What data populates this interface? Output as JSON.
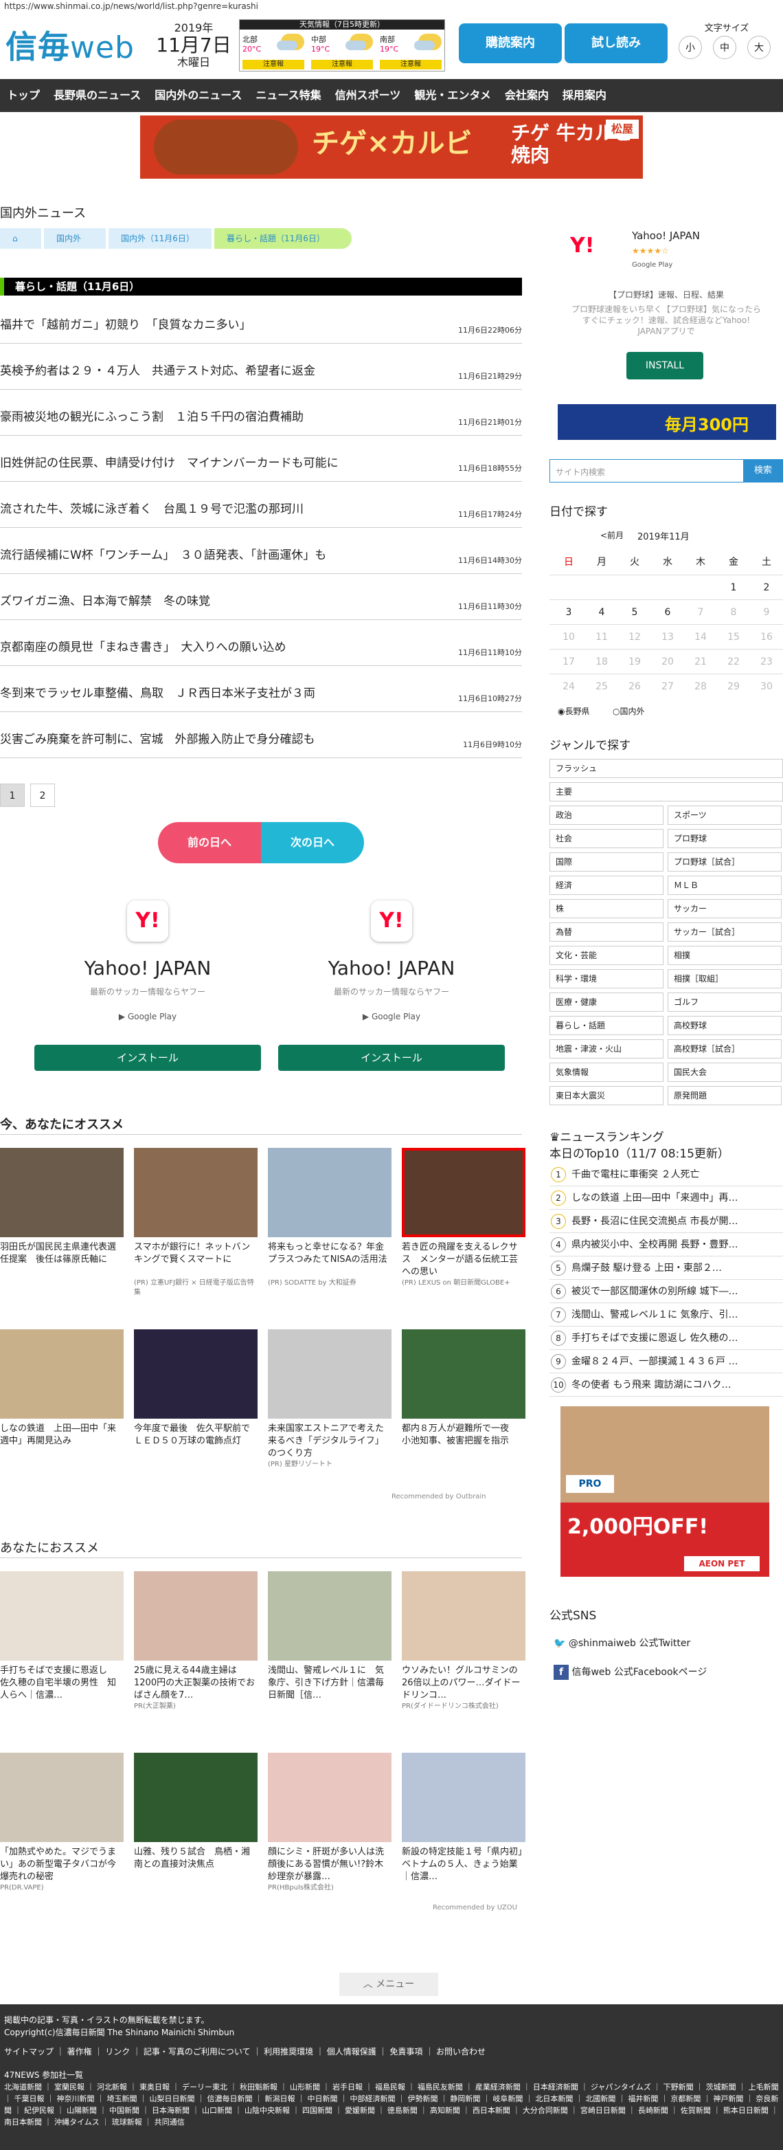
{
  "url": "https://www.shinmai.co.jp/news/world/list.php?genre=kurashi",
  "logo": {
    "main": "信毎",
    "sub": "web"
  },
  "date": {
    "year": "2019年",
    "md": "11月7日",
    "wd": "木曜日"
  },
  "weather": {
    "title": "天気情報（7日5時更新）",
    "cols": [
      {
        "name": "北部",
        "hi": "20°C",
        "lo": "",
        "chance": "注意報"
      },
      {
        "name": "中部",
        "hi": "19°C",
        "lo": "",
        "chance": "注意報"
      },
      {
        "name": "南部",
        "hi": "19°C",
        "lo": "",
        "chance": "注意報"
      }
    ]
  },
  "buttons": {
    "subscribe": "購読案内",
    "trial": "試し読み"
  },
  "fontsize": {
    "label": "文字サイズ",
    "s": "小",
    "m": "中",
    "l": "大"
  },
  "nav": [
    "トップ",
    "長野県のニュース",
    "国内外のニュース",
    "ニュース特集",
    "信州スポーツ",
    "観光・エンタメ",
    "会社案内",
    "採用案内"
  ],
  "banner": {
    "t1": "チゲ×カルビ",
    "t2": "チゲ 牛カルビ焼肉",
    "mark": "松屋"
  },
  "section_title": "国内外ニュース",
  "breadcrumb": [
    "国内外",
    "国内外（11月6日）",
    "暮らし・話題（11月6日）"
  ],
  "catbar": "暮らし・話題（11月6日）",
  "news": [
    {
      "t": "福井で「越前ガニ」初競り　「良質なカニ多い」",
      "d": "11月6日22時06分"
    },
    {
      "t": "英検予約者は２９・４万人　共通テスト対応、希望者に返金",
      "d": "11月6日21時29分"
    },
    {
      "t": "豪雨被災地の観光にふっこう割　１泊５千円の宿泊費補助",
      "d": "11月6日21時01分"
    },
    {
      "t": "旧姓併記の住民票、申請受け付け　マイナンバーカードも可能に",
      "d": "11月6日18時55分"
    },
    {
      "t": "流された牛、茨城に泳ぎ着く　台風１９号で氾濫の那珂川",
      "d": "11月6日17時24分"
    },
    {
      "t": "流行語候補にW杯「ワンチーム」　３０語発表、「計画運休」も",
      "d": "11月6日14時30分"
    },
    {
      "t": "ズワイガニ漁、日本海で解禁　冬の味覚",
      "d": "11月6日11時30分"
    },
    {
      "t": "京都南座の顔見世「まねき書き」　大入りへの願い込め",
      "d": "11月6日11時10分"
    },
    {
      "t": "冬到来でラッセル車整備、鳥取　ＪＲ西日本米子支社が３両",
      "d": "11月6日10時27分"
    },
    {
      "t": "災害ごみ廃棄を許可制に、宮城　外部搬入防止で身分確認も",
      "d": "11月6日9時10分"
    }
  ],
  "pages": [
    "1",
    "2"
  ],
  "daybtns": {
    "prev": "前の日へ",
    "next": "次の日へ"
  },
  "yad": {
    "title": "Yahoo! JAPAN",
    "sub": "最新のサッカー情報ならヤフー",
    "gp": "Google Play",
    "btn": "インストール"
  },
  "reco_title": "今、あなたにオススメ",
  "reco": [
    {
      "c": "羽田氏が国民民主県連代表選任提案　後任は篠原氏軸に",
      "p": ""
    },
    {
      "c": "スマホが銀行に！ネットバンキングで賢くスマートに",
      "p": "(PR) 立憲UFJ銀行 × 日経電子版広告特集"
    },
    {
      "c": "将来もっと幸せになる？年金プラスつみたてNISAの活用法",
      "p": "(PR) SODATTE by 大和証券"
    },
    {
      "c": "若き匠の飛躍を支えるレクサス　メンターが語る伝統工芸への思い",
      "p": "(PR) LEXUS on 朝日新聞GLOBE+"
    },
    {
      "c": "しなの鉄道　上田―田中「来週中」再開見込み",
      "p": ""
    },
    {
      "c": "今年度で最後　佐久平駅前でＬＥＤ５０万球の電飾点灯",
      "p": ""
    },
    {
      "c": "未来国家エストニアで考えた来るべき「デジタルライフ」のつくり方",
      "p": "(PR) 星野リゾートト"
    },
    {
      "c": "都内８万人が避難所で一夜　小池知事、被害把握を指示",
      "p": ""
    }
  ],
  "outbrain": "Recommended by Outbrain",
  "reco2_title": "あなたにおススメ",
  "reco2": [
    {
      "c": "手打ちそばで支援に恩返し　佐久穂の自宅半壊の男性　知人らへ｜信濃…",
      "p": ""
    },
    {
      "c": "25歳に見える44歳主婦は1200円の大正製薬の技術でおばさん顔を7…",
      "p": "PR(大正製薬)"
    },
    {
      "c": "浅間山、警戒レベル１に　気象庁、引き下げ方針｜信濃毎日新聞［信…",
      "p": ""
    },
    {
      "c": "ウソみたい！グルコサミンの26倍以上のパワー…ダイドードリンコ…",
      "p": "PR(ダイドードリンコ株式会社)"
    },
    {
      "c": "「加熱式やめた。マジでうまい」あの新型電子タバコが今爆売れの秘密",
      "p": "PR(DR.VAPE)"
    },
    {
      "c": "山雅、残り５試合　鳥栖・湘南との直接対決焦点",
      "p": ""
    },
    {
      "c": "顔にシミ・肝斑が多い人は洗顔後にある習慣が無い!?鈴木紗理奈が暴露…",
      "p": "PR(HBpuls株式会社)"
    },
    {
      "c": "新設の特定技能１号「県内初」　ベトナムの５人、きょう始業｜信濃…",
      "p": ""
    }
  ],
  "uzou": "Recommended by UZOU",
  "menu": "メニュー",
  "side_yad": {
    "name": "Yahoo! JAPAN",
    "stars": "★★★★☆",
    "gp": "Google Play",
    "cat": "【プロ野球】速報、日程、結果",
    "desc": "プロ野球速報をいち早く【プロ野球】気になったらすぐにチェック！速報、試合経過などYahoo! JAPANアプリで",
    "btn": "INSTALL"
  },
  "side_banner": "毎月300円",
  "search": {
    "placeholder": "サイト内検索",
    "btn": "検索"
  },
  "cal": {
    "title": "日付で探す",
    "prev": "<前月",
    "month": "2019年11月",
    "wd": [
      "日",
      "月",
      "火",
      "水",
      "木",
      "金",
      "土"
    ],
    "rows": [
      [
        "",
        "",
        "",
        "",
        "",
        "1",
        "2"
      ],
      [
        "3",
        "4",
        "5",
        "6",
        "7",
        "8",
        "9"
      ],
      [
        "10",
        "11",
        "12",
        "13",
        "14",
        "15",
        "16"
      ],
      [
        "17",
        "18",
        "19",
        "20",
        "21",
        "22",
        "23"
      ],
      [
        "24",
        "25",
        "26",
        "27",
        "28",
        "29",
        "30"
      ]
    ],
    "radio1": "長野県",
    "radio2": "国内外"
  },
  "genre_title": "ジャンルで探す",
  "genres": [
    [
      "フラッシュ"
    ],
    [
      "主要"
    ],
    [
      "政治",
      "スポーツ"
    ],
    [
      "社会",
      "プロ野球"
    ],
    [
      "国際",
      "プロ野球［試合］"
    ],
    [
      "経済",
      "ＭＬＢ"
    ],
    [
      "株",
      "サッカー"
    ],
    [
      "為替",
      "サッカー［試合］"
    ],
    [
      "文化・芸能",
      "相撲"
    ],
    [
      "科学・環境",
      "相撲［取組］"
    ],
    [
      "医療・健康",
      "ゴルフ"
    ],
    [
      "暮らし・話題",
      "高校野球"
    ],
    [
      "地震・津波・火山",
      "高校野球［試合］"
    ],
    [
      "気象情報",
      "国民大会"
    ],
    [
      "東日本大震災",
      "原発問題"
    ]
  ],
  "ranking_title": "ニュースランキング",
  "ranking_sub": "本日のTop10（11/7 08:15更新）",
  "ranking": [
    "千曲で電柱に車衝突 ２人死亡",
    "しなの鉄道 上田―田中「来週中」再…",
    "長野・長沼に住民交流拠点 市長が開…",
    "県内被災小中、全校再開 長野・豊野…",
    "鳥爛子鼓 駆け登る 上田・東部２…",
    "被災で一部区間運休の別所線 城下―…",
    "浅間山、警戒レベル１に 気象庁、引…",
    "手打ちそばで支援に恩返し 佐久穂の…",
    "金曜８２４戸、一部撲滅１４３６戸 …",
    "冬の使者 もう飛来 諏訪湖にコハク…"
  ],
  "pet": {
    "brand": "PRO",
    "price": "2,000円OFF!",
    "store": "AEON PET"
  },
  "sns_title": "公式SNS",
  "sns": [
    "@shinmaiweb 公式Twitter",
    "信毎web 公式Facebookページ"
  ],
  "footer": {
    "notice": "掲載中の記事・写真・イラストの無断転載を禁じます。",
    "copy": "Copyright(c)信濃毎日新聞 The Shinano Mainichi Shimbun",
    "links": "サイトマップ ｜ 著作権 ｜ リンク ｜ 記事・写真のご利用について ｜ 利用推奨環境 ｜ 個人情報保護 ｜ 免責事項 ｜ お問い合わせ",
    "news47": "47NEWS 参加社一覧",
    "papers": "北海道新聞 ｜ 室蘭民報 ｜ 河北新報 ｜ 東奥日報 ｜ デーリー東北 ｜ 秋田魁新報 ｜ 山形新聞 ｜ 岩手日報 ｜ 福島民報 ｜ 福島民友新聞 ｜ 産業経済新聞 ｜ 日本経済新聞 ｜ ジャパンタイムズ ｜ 下野新聞 ｜ 茨城新聞 ｜ 上毛新聞 ｜ 千葉日報 ｜ 神奈川新聞 ｜ 埼玉新聞 ｜ 山梨日日新聞 ｜ 信濃毎日新聞 ｜ 新潟日報 ｜ 中日新聞 ｜ 中部経済新聞 ｜ 伊勢新聞 ｜ 静岡新聞 ｜ 岐阜新聞 ｜ 北日本新聞 ｜ 北國新聞 ｜ 福井新聞 ｜ 京都新聞 ｜ 神戸新聞 ｜ 奈良新聞 ｜ 紀伊民報 ｜ 山陽新聞 ｜ 中国新聞 ｜ 日本海新聞 ｜ 山口新聞 ｜ 山陰中央新報 ｜ 四国新聞 ｜ 愛媛新聞 ｜ 徳島新聞 ｜ 高知新聞 ｜ 西日本新聞 ｜ 大分合同新聞 ｜ 宮崎日日新聞 ｜ 長崎新聞 ｜ 佐賀新聞 ｜ 熊本日日新聞 ｜ 南日本新聞 ｜ 沖縄タイムス ｜ 琉球新報 ｜ 共同通信"
  }
}
